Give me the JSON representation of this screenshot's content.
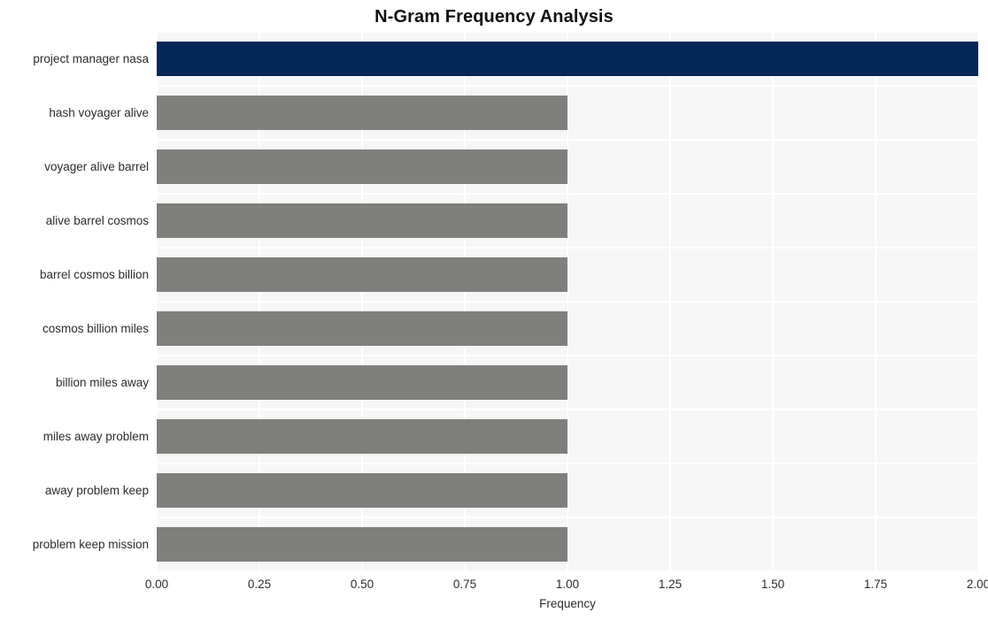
{
  "chart_data": {
    "type": "bar",
    "orientation": "horizontal",
    "title": "N-Gram Frequency Analysis",
    "xlabel": "Frequency",
    "ylabel": "",
    "categories": [
      "project manager nasa",
      "hash voyager alive",
      "voyager alive barrel",
      "alive barrel cosmos",
      "barrel cosmos billion",
      "cosmos billion miles",
      "billion miles away",
      "miles away problem",
      "away problem keep",
      "problem keep mission"
    ],
    "values": [
      2,
      1,
      1,
      1,
      1,
      1,
      1,
      1,
      1,
      1
    ],
    "bar_colors": [
      "#042755",
      "#7f7f7c",
      "#7f7f7c",
      "#7f7f7c",
      "#7f7f7c",
      "#7f7f7c",
      "#7f7f7c",
      "#7f7f7c",
      "#7f7f7c",
      "#7f7f7c"
    ],
    "xlim": [
      0.0,
      2.0
    ],
    "xticks": [
      0.0,
      0.25,
      0.5,
      0.75,
      1.0,
      1.25,
      1.5,
      1.75,
      2.0
    ],
    "xtick_labels": [
      "0.00",
      "0.25",
      "0.50",
      "0.75",
      "1.00",
      "1.25",
      "1.50",
      "1.75",
      "2.00"
    ],
    "grid": true,
    "grid_color": "#ffffff",
    "plot_background": "#f6f6f7",
    "figure_background": "#ffffff",
    "legend": null,
    "legend_position": "none",
    "annotations": []
  }
}
